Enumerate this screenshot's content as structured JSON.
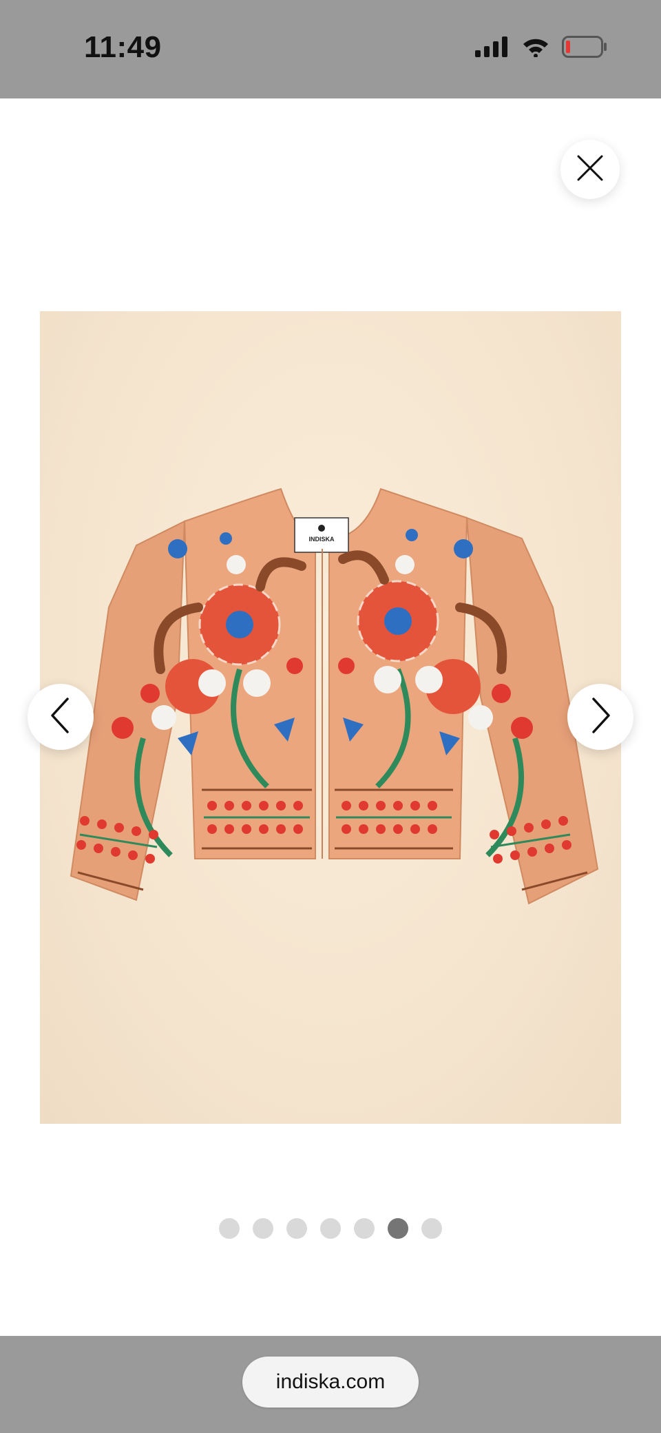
{
  "status_bar": {
    "time": "11:49",
    "icons": [
      "signal-icon",
      "wifi-icon",
      "battery-low-icon"
    ]
  },
  "viewer": {
    "close_icon": "close-icon",
    "prev_icon": "chevron-left-icon",
    "next_icon": "chevron-right-icon",
    "image": {
      "subject": "embroidered-jacket",
      "label_brand": "INDISKA"
    },
    "pagination": {
      "total": 7,
      "active_index": 5
    }
  },
  "browser": {
    "url": "indiska.com"
  },
  "colors": {
    "bars": "#9a9a9a",
    "jacket": "#e8a47c",
    "dot_inactive": "#d9d9d9",
    "dot_active": "#757575"
  }
}
